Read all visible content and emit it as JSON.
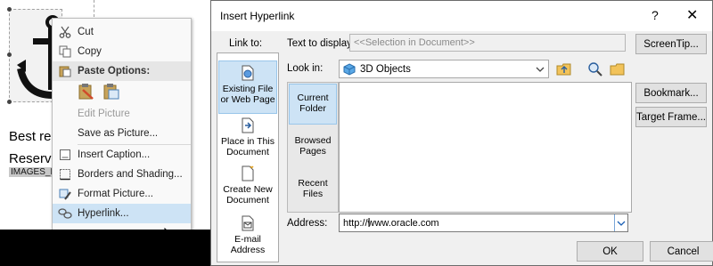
{
  "document": {
    "line1": "Best reg",
    "line2": "Reservat",
    "field": "IMAGES_PAT"
  },
  "context_menu": {
    "items": [
      {
        "label": "Cut",
        "icon": "scissors-icon",
        "enabled": true
      },
      {
        "label": "Copy",
        "icon": "copy-icon",
        "enabled": true
      },
      {
        "label": "Paste Options:",
        "icon": "paste-icon",
        "enabled": true
      },
      {
        "label": "Edit Picture",
        "icon": "",
        "enabled": false
      },
      {
        "label": "Save as Picture...",
        "icon": "",
        "enabled": true
      },
      {
        "label": "Insert Caption...",
        "icon": "caption-icon",
        "enabled": true
      },
      {
        "label": "Borders and Shading...",
        "icon": "borders-icon",
        "enabled": true
      },
      {
        "label": "Format Picture...",
        "icon": "format-picture-icon",
        "enabled": true
      },
      {
        "label": "Hyperlink...",
        "icon": "hyperlink-icon",
        "enabled": true,
        "highlighted": true
      }
    ]
  },
  "dialog": {
    "title": "Insert Hyperlink",
    "help_glyph": "?",
    "close_glyph": "✕",
    "link_to_label": "Link to:",
    "text_to_display_label": "Text to display:",
    "text_to_display_value": "<<Selection in Document>>",
    "screentip_button": "ScreenTip...",
    "look_in_label": "Look in:",
    "look_in_value": "3D Objects",
    "bookmark_button": "Bookmark...",
    "target_frame_button": "Target Frame...",
    "link_to_items": [
      {
        "label": "Existing File or Web Page",
        "selected": true
      },
      {
        "label": "Place in This Document",
        "selected": false
      },
      {
        "label": "Create New Document",
        "selected": false
      },
      {
        "label": "E-mail Address",
        "selected": false
      }
    ],
    "locations": [
      {
        "label": "Current Folder",
        "selected": true
      },
      {
        "label": "Browsed Pages",
        "selected": false
      },
      {
        "label": "Recent Files",
        "selected": false
      }
    ],
    "address_label": "Address:",
    "address_value": "http://www.oracle.com",
    "ok_button": "OK",
    "cancel_button": "Cancel"
  },
  "colors": {
    "selection": "#cde3f5",
    "dialog_bg": "#f0f0f0",
    "accent": "#0078d7"
  }
}
